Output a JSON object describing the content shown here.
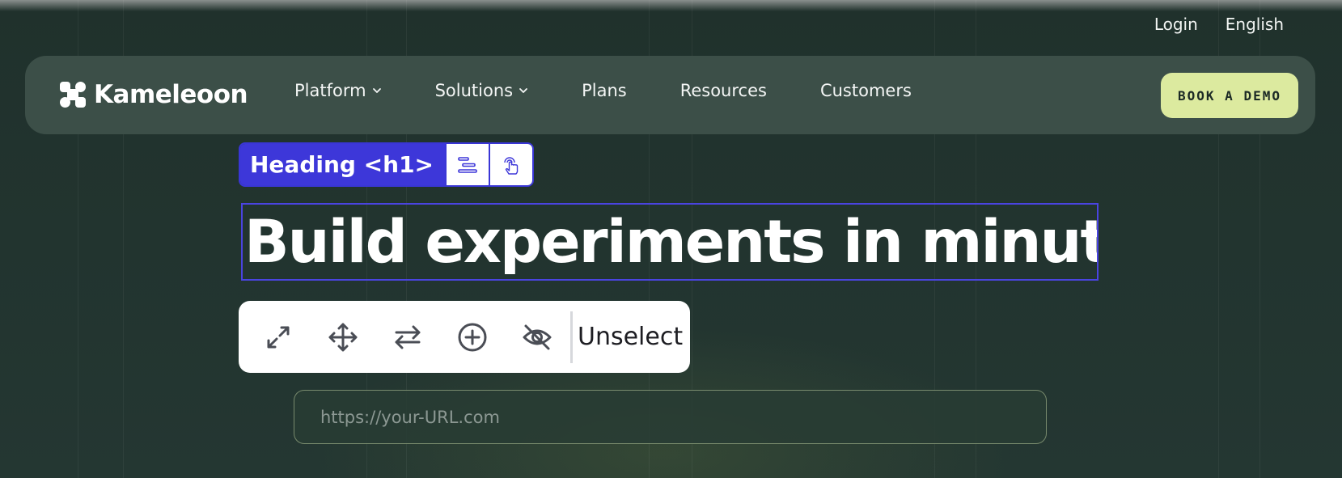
{
  "utility": {
    "login": "Login",
    "language": "English"
  },
  "brand": {
    "name": "Kameleoon"
  },
  "nav": {
    "items": [
      {
        "label": "Platform",
        "has_dropdown": true
      },
      {
        "label": "Solutions",
        "has_dropdown": true
      },
      {
        "label": "Plans",
        "has_dropdown": false
      },
      {
        "label": "Resources",
        "has_dropdown": false
      },
      {
        "label": "Customers",
        "has_dropdown": false
      }
    ],
    "cta": "BOOK A DEMO"
  },
  "editor": {
    "element_tag": "Heading <h1>",
    "tag_buttons": [
      "align-icon",
      "pointer-icon"
    ],
    "toolbar": {
      "tools": [
        "resize-icon",
        "move-icon",
        "swap-icon",
        "add-icon",
        "hide-icon"
      ],
      "unselect": "Unselect"
    }
  },
  "hero": {
    "heading": "Build experiments in minutes"
  },
  "url_field": {
    "placeholder": "https://your-URL.com",
    "value": ""
  },
  "colors": {
    "background": "#223530",
    "navbar": "#3c4f48",
    "cta": "#dcea9f",
    "selection": "#3d37d9",
    "toolbar": "#ffffff"
  }
}
